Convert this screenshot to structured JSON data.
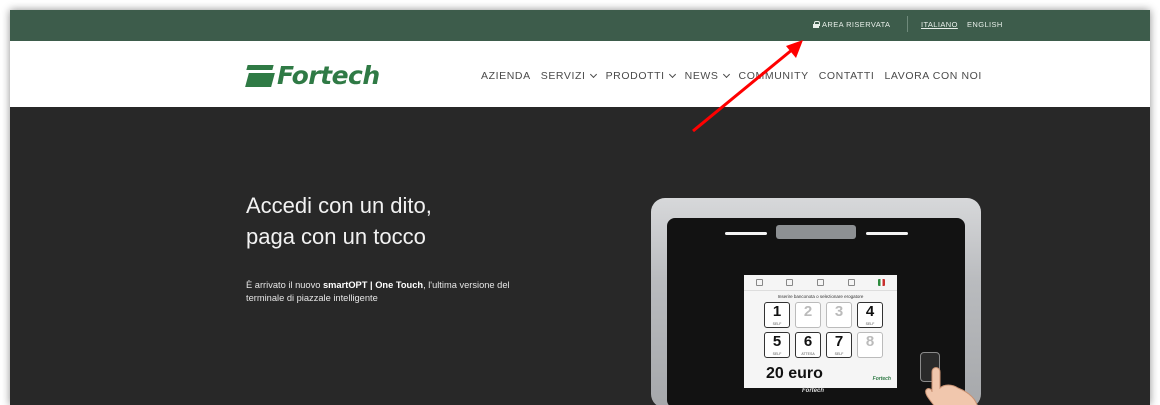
{
  "topbar": {
    "area_riservata": "AREA RISERVATA",
    "lang_it": "ITALIANO",
    "lang_en": "ENGLISH",
    "bg_color": "#3d5c4b"
  },
  "brand": {
    "name": "Fortech",
    "color": "#2f7a45"
  },
  "nav": {
    "items": [
      {
        "label": "AZIENDA",
        "dropdown": false
      },
      {
        "label": "SERVIZI",
        "dropdown": true
      },
      {
        "label": "PRODOTTI",
        "dropdown": true
      },
      {
        "label": "NEWS",
        "dropdown": true
      },
      {
        "label": "COMMUNITY",
        "dropdown": false
      },
      {
        "label": "CONTATTI",
        "dropdown": false
      },
      {
        "label": "LAVORA CON NOI",
        "dropdown": false
      }
    ]
  },
  "hero": {
    "headline_line1": "Accedi con un dito,",
    "headline_line2": "paga con un tocco",
    "intro_pre": "È arrivato il nuovo ",
    "intro_bold": "smartOPT | One Touch",
    "intro_post": ", l'ultima versione del terminale di piazzale intelligente",
    "bg_color": "#282828"
  },
  "device_screen": {
    "message": "Inserire banconota o selezionare erogatore",
    "keys": [
      {
        "num": "1",
        "sub": "SELF",
        "disabled": false
      },
      {
        "num": "2",
        "sub": "",
        "disabled": true
      },
      {
        "num": "3",
        "sub": "",
        "disabled": true
      },
      {
        "num": "4",
        "sub": "SELF",
        "disabled": false
      },
      {
        "num": "5",
        "sub": "SELF",
        "disabled": false
      },
      {
        "num": "6",
        "sub": "ATTESA",
        "disabled": false
      },
      {
        "num": "7",
        "sub": "SELF",
        "disabled": false
      },
      {
        "num": "8",
        "sub": "",
        "disabled": true
      }
    ],
    "amount": "20 euro",
    "brand": "Fortech"
  },
  "annotation": {
    "arrow_color": "#ff0000"
  }
}
